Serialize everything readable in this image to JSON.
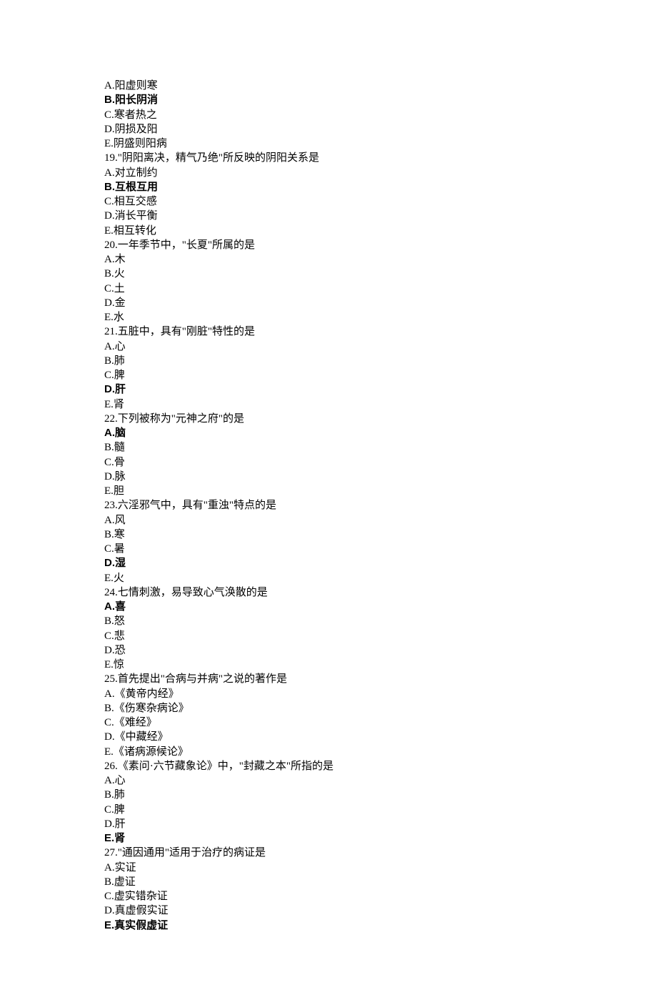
{
  "lines": [
    {
      "text": "A.阳虚则寒",
      "bold": false
    },
    {
      "text": "B.阳长阴消",
      "bold": true
    },
    {
      "text": "C.寒者热之",
      "bold": false
    },
    {
      "text": "D.阴损及阳",
      "bold": false
    },
    {
      "text": "E.阴盛则阳病",
      "bold": false
    },
    {
      "text": "19.\"阴阳离决，精气乃绝\"所反映的阴阳关系是",
      "bold": false
    },
    {
      "text": "A.对立制约",
      "bold": false
    },
    {
      "text": "B.互根互用",
      "bold": true
    },
    {
      "text": "C.相互交感",
      "bold": false
    },
    {
      "text": "D.消长平衡",
      "bold": false
    },
    {
      "text": "E.相互转化",
      "bold": false
    },
    {
      "text": "20.一年季节中，\"长夏\"所属的是",
      "bold": false
    },
    {
      "text": "A.木",
      "bold": false
    },
    {
      "text": "B.火",
      "bold": false
    },
    {
      "text": "C.土",
      "bold": false
    },
    {
      "text": "D.金",
      "bold": false
    },
    {
      "text": "E.水",
      "bold": false
    },
    {
      "text": "21.五脏中，具有\"刚脏\"特性的是",
      "bold": false
    },
    {
      "text": "A.心",
      "bold": false
    },
    {
      "text": "B.肺",
      "bold": false
    },
    {
      "text": "C.脾",
      "bold": false
    },
    {
      "text": "D.肝",
      "bold": true
    },
    {
      "text": "E.肾",
      "bold": false
    },
    {
      "text": "22.下列被称为\"元神之府\"的是",
      "bold": false
    },
    {
      "text": "A.脑",
      "bold": true
    },
    {
      "text": "B.髓",
      "bold": false
    },
    {
      "text": "C.骨",
      "bold": false
    },
    {
      "text": "D.脉",
      "bold": false
    },
    {
      "text": "E.胆",
      "bold": false
    },
    {
      "text": "23.六淫邪气中，具有\"重浊\"特点的是",
      "bold": false
    },
    {
      "text": "A.风",
      "bold": false
    },
    {
      "text": "B.寒",
      "bold": false
    },
    {
      "text": "C.暑",
      "bold": false
    },
    {
      "text": "D.湿",
      "bold": true
    },
    {
      "text": "E.火",
      "bold": false
    },
    {
      "text": "24.七情刺激，易导致心气涣散的是",
      "bold": false
    },
    {
      "text": "A.喜",
      "bold": true
    },
    {
      "text": "B.怒",
      "bold": false
    },
    {
      "text": "C.悲",
      "bold": false
    },
    {
      "text": "D.恐",
      "bold": false
    },
    {
      "text": "E.惊",
      "bold": false
    },
    {
      "text": "25.首先提出\"合病与并病\"之说的著作是",
      "bold": false
    },
    {
      "text": "A.《黄帝内经》",
      "bold": false
    },
    {
      "text": "B.《伤寒杂病论》",
      "bold": false
    },
    {
      "text": "C.《难经》",
      "bold": false
    },
    {
      "text": "D.《中藏经》",
      "bold": false
    },
    {
      "text": "E.《诸病源候论》",
      "bold": false
    },
    {
      "text": "26.《素问·六节藏象论》中，\"封藏之本\"所指的是",
      "bold": false
    },
    {
      "text": "A.心",
      "bold": false
    },
    {
      "text": "B.肺",
      "bold": false
    },
    {
      "text": "C.脾",
      "bold": false
    },
    {
      "text": "D.肝",
      "bold": false
    },
    {
      "text": "E.肾",
      "bold": true
    },
    {
      "text": "27.\"通因通用\"适用于治疗的病证是",
      "bold": false
    },
    {
      "text": "A.实证",
      "bold": false
    },
    {
      "text": "B.虚证",
      "bold": false
    },
    {
      "text": "C.虚实错杂证",
      "bold": false
    },
    {
      "text": "D.真虚假实证",
      "bold": false
    },
    {
      "text": "E.真实假虚证",
      "bold": true
    }
  ]
}
